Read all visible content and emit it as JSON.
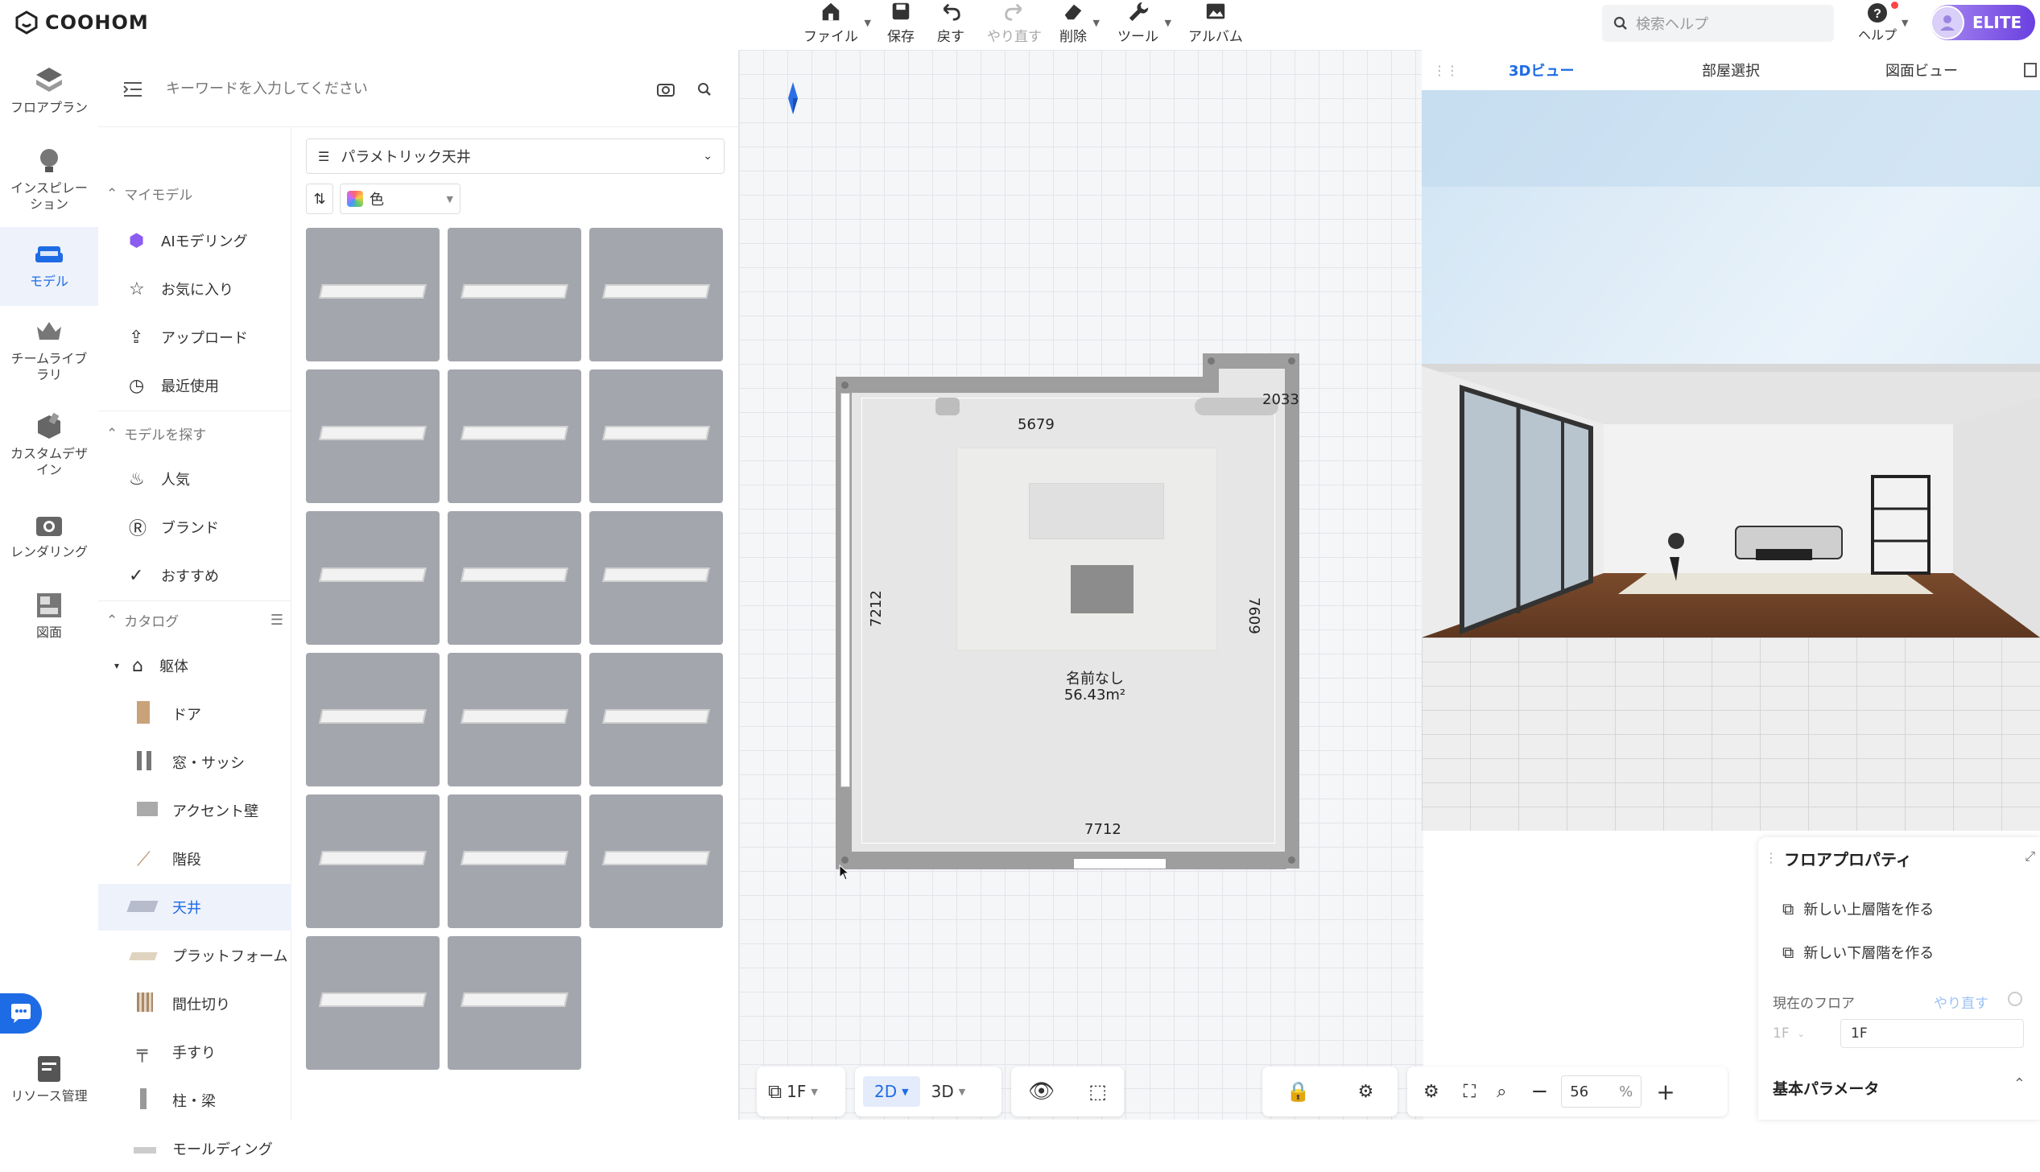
{
  "app": {
    "logo_text": "COOHOM"
  },
  "toolbar": {
    "file": "ファイル",
    "save": "保存",
    "undo": "戻す",
    "redo": "やり直す",
    "delete": "削除",
    "tools": "ツール",
    "album": "アルバム"
  },
  "header": {
    "search_placeholder": "検索ヘルプ",
    "help": "ヘルプ",
    "badge": "ELITE"
  },
  "leftnav": [
    {
      "label": "フロアプラン",
      "icon": "floorplan-icon"
    },
    {
      "label": "インスピレーション",
      "icon": "lightbulb-icon"
    },
    {
      "label": "モデル",
      "icon": "sofa-icon",
      "active": true
    },
    {
      "label": "チームライブラリ",
      "icon": "crown-icon"
    },
    {
      "label": "カスタムデザイン",
      "icon": "custom-box-icon"
    },
    {
      "label": "レンダリング",
      "icon": "camera-icon"
    },
    {
      "label": "図面",
      "icon": "drawing-icon"
    },
    {
      "label": "リソース管理",
      "icon": "resource-icon"
    }
  ],
  "panel": {
    "search_placeholder": "キーワードを入力してください",
    "sections": {
      "my_models": "マイモデル",
      "find_models": "モデルを探す",
      "catalog": "カタログ"
    },
    "my_models": [
      "AIモデリング",
      "お気に入り",
      "アップロード",
      "最近使用"
    ],
    "find_models": [
      "人気",
      "ブランド",
      "おすすめ"
    ],
    "catalog_parent": "躯体",
    "catalog": [
      "ドア",
      "窓・サッシ",
      "アクセント壁",
      "階段",
      "天井",
      "プラットフォーム",
      "間仕切り",
      "手すり",
      "柱・梁",
      "モールディング"
    ],
    "selected_catalog": "天井",
    "filter_label": "パラメトリック天井",
    "color_filter": "色"
  },
  "floorplan": {
    "room_name": "名前なし",
    "room_area": "56.43m²",
    "dim_top": "5679",
    "dim_top_right": "2033",
    "dim_left": "7212",
    "dim_right": "7609",
    "dim_bottom": "7712"
  },
  "view_tabs": [
    "3Dビュー",
    "部屋選択",
    "図面ビュー"
  ],
  "active_view_tab": "3Dビュー",
  "properties": {
    "title": "フロアプロパティ",
    "new_upper": "新しい上層階を作る",
    "new_lower": "新しい下層階を作る",
    "current_floor_label": "現在のフロア",
    "redo_link": "やり直す",
    "floor_select": "1F",
    "floor_input": "1F",
    "basic_params": "基本パラメータ"
  },
  "bottom": {
    "floor": "1F",
    "mode_2d": "2D",
    "mode_3d": "3D",
    "zoom": "56",
    "zoom_unit": "%"
  },
  "colors": {
    "accent": "#1e6be6",
    "elite": "#7b4fe0"
  }
}
